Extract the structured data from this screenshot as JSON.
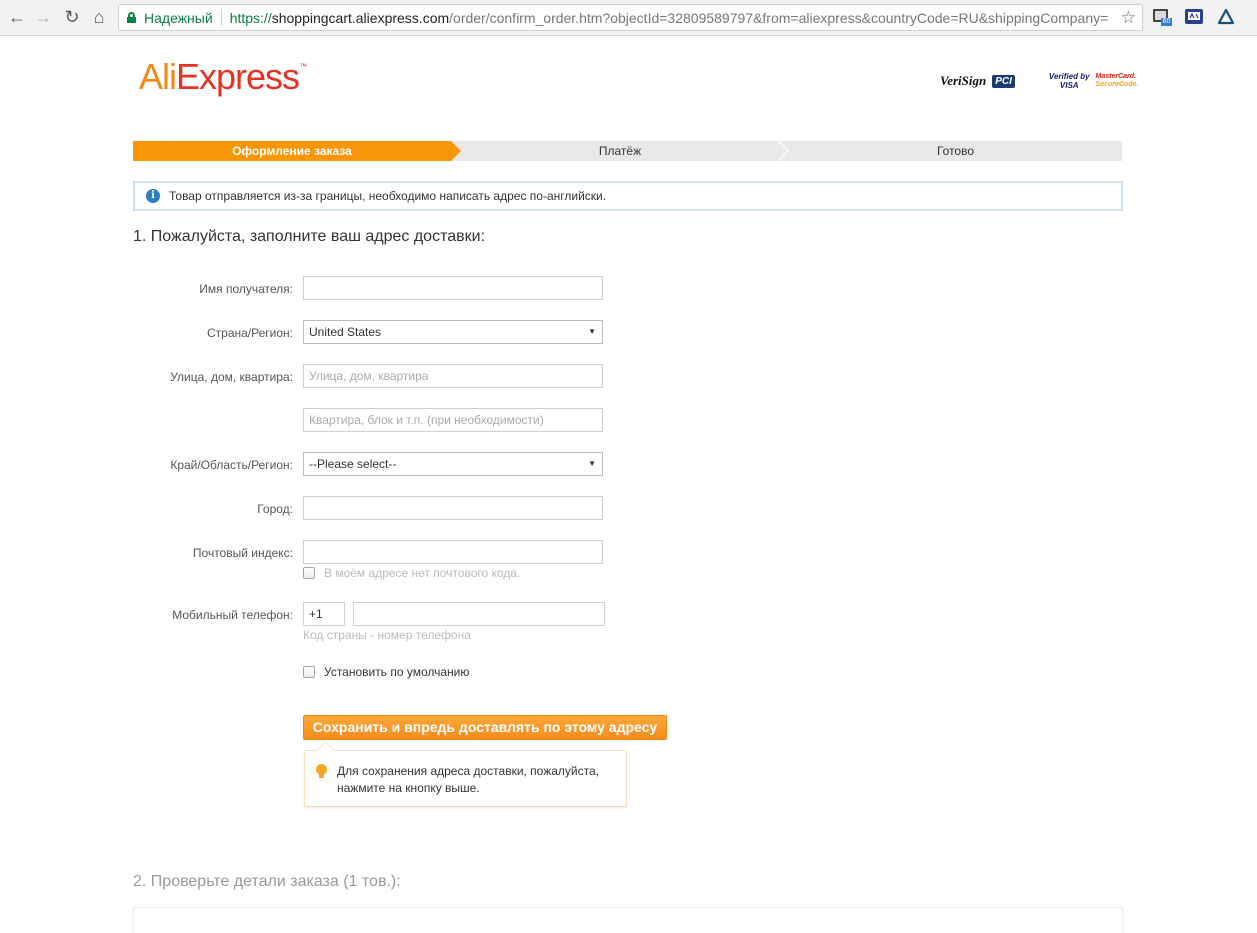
{
  "browser": {
    "secure_label": "Надежный",
    "url_scheme": "https://",
    "url_host": "shoppingcart.aliexpress.com",
    "url_path": "/order/confirm_order.htm?objectId=32809589797&from=aliexpress&countryCode=RU&shippingCompany=",
    "ext_badge": "60"
  },
  "header": {
    "logo_ali": "Ali",
    "logo_express": "Express",
    "logo_tm": "™",
    "badges": {
      "verisign": "VeriSign",
      "pci": "PCI",
      "visa_line1": "Verified by",
      "visa_line2": "VISA",
      "mc_line1": "MasterCard.",
      "mc_line2": "SecureCode."
    }
  },
  "steps": [
    "Оформление заказа",
    "Платёж",
    "Готово"
  ],
  "notice": "Товар отправляется из-за границы, необходимо написать адрес по-английски.",
  "section1_title": "1. Пожалуйста, заполните ваш адрес доставки:",
  "form": {
    "recipient_label": "Имя получателя:",
    "recipient_value": "",
    "country_label": "Страна/Регион:",
    "country_value": "United States",
    "street_label": "Улица, дом, квартира:",
    "street_placeholder": "Улица, дом, квартира",
    "apt_placeholder": "Квартира, блок и т.п. (при необходимости)",
    "region_label": "Край/Область/Регион:",
    "region_value": "--Please select--",
    "city_label": "Город:",
    "zip_label": "Почтовый индекс:",
    "no_zip_label": "В моём адресе нет почтового кода.",
    "phone_label": "Мобильный телефон:",
    "phone_code": "+1",
    "phone_hint": "Код страны - номер телефона",
    "default_label": "Установить по умолчанию"
  },
  "save_button": "Сохранить и впредь доставлять по этому адресу",
  "tip_text": "Для сохранения адреса доставки, пожалуйста, нажмите на кнопку выше.",
  "section2_title": "2. Проверьте детали заказа (1 тов.):",
  "colors": {
    "brand_orange": "#f89609",
    "ali_orange": "#f28a12",
    "express_red": "#e43225",
    "secure_green": "#0b8043",
    "info_blue": "#2b7fc7"
  }
}
